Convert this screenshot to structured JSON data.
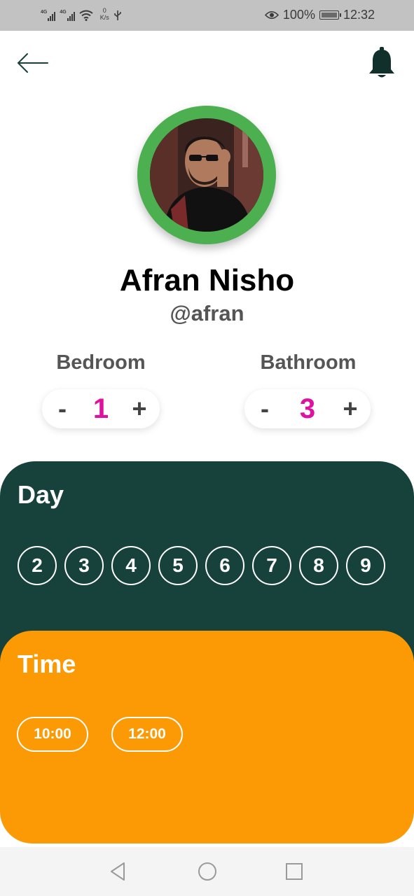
{
  "status_bar": {
    "signal1_label": "4G",
    "signal2_label": "4G",
    "speed_value": "0",
    "speed_unit": "K/s",
    "battery": "100%",
    "time": "12:32",
    "icons": [
      "signal-icon",
      "wifi-icon",
      "usb-icon",
      "eye-icon",
      "battery-icon"
    ]
  },
  "header": {
    "back_icon": "arrow-left-icon",
    "notification_icon": "bell-icon"
  },
  "profile": {
    "name": "Afran Nisho",
    "handle": "@afran",
    "avatar_ring_color": "#4caf50"
  },
  "counters": [
    {
      "label": "Bedroom",
      "value": "1",
      "decrement": "-",
      "increment": "+"
    },
    {
      "label": "Bathroom",
      "value": "3",
      "decrement": "-",
      "increment": "+"
    }
  ],
  "day_section": {
    "title": "Day",
    "days": [
      "2",
      "3",
      "4",
      "5",
      "6",
      "7",
      "8",
      "9"
    ],
    "background": "#17423c"
  },
  "time_section": {
    "title": "Time",
    "slots": [
      "10:00",
      "12:00"
    ],
    "background": "#fb9a05"
  },
  "nav_bar": {
    "icons": [
      "back-triangle-icon",
      "home-circle-icon",
      "recents-square-icon"
    ]
  },
  "colors": {
    "accent_value": "#e0119f"
  }
}
